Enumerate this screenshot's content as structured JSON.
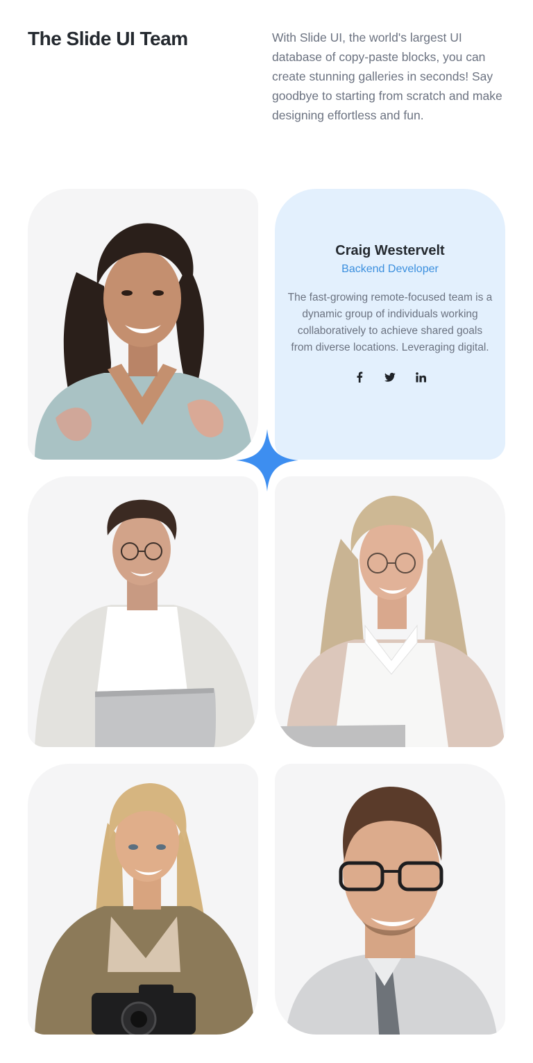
{
  "header": {
    "title": "The Slide UI Team",
    "intro": "With Slide UI, the world's largest UI database of copy-paste blocks, you can create stunning galleries in seconds! Say goodbye to starting from scratch and make designing effortless and fun."
  },
  "profile": {
    "name": "Craig Westervelt",
    "role": "Backend Developer",
    "bio": "The fast-growing remote-focused team is a dynamic group of individuals working collaboratively to achieve shared goals from diverse locations. Leveraging digital.",
    "socials": [
      "facebook-icon",
      "twitter-icon",
      "linkedin-icon"
    ]
  },
  "colors": {
    "accent": "#3b8fde",
    "star": "#3d8ef0",
    "profile_bg": "#e3f0fd",
    "card_bg": "#f5f5f6"
  }
}
